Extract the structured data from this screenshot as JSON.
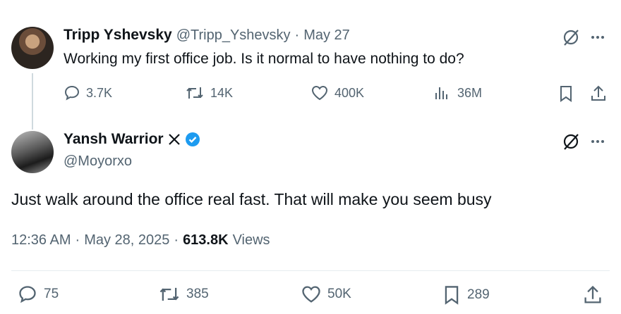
{
  "tweet1": {
    "name": "Tripp Yshevsky",
    "handle": "@Tripp_Yshevsky",
    "separator": "·",
    "date": "May 27",
    "text": "Working my first office job. Is it normal to have nothing to do?",
    "actions": {
      "replies": "3.7K",
      "retweets": "14K",
      "likes": "400K",
      "views": "36M"
    }
  },
  "tweet2": {
    "name": "Yansh Warrior",
    "handle": "@Moyorxo",
    "text": "Just walk around the office real fast. That will make you seem busy",
    "meta": {
      "time": "12:36 AM",
      "sep1": "·",
      "date": "May 28, 2025",
      "sep2": "·",
      "views_count": "613.8K",
      "views_label": "Views"
    },
    "actions": {
      "replies": "75",
      "retweets": "385",
      "likes": "50K",
      "bookmarks": "289"
    }
  },
  "colors": {
    "text": "#0f1419",
    "muted": "#536471",
    "verified": "#1d9bf0",
    "divider": "#e6ecf0"
  },
  "icons": [
    "grok-icon",
    "more-icon",
    "reply-icon",
    "retweet-icon",
    "like-icon",
    "views-icon",
    "bookmark-icon",
    "share-icon",
    "x-logo-icon",
    "verified-badge-icon"
  ]
}
